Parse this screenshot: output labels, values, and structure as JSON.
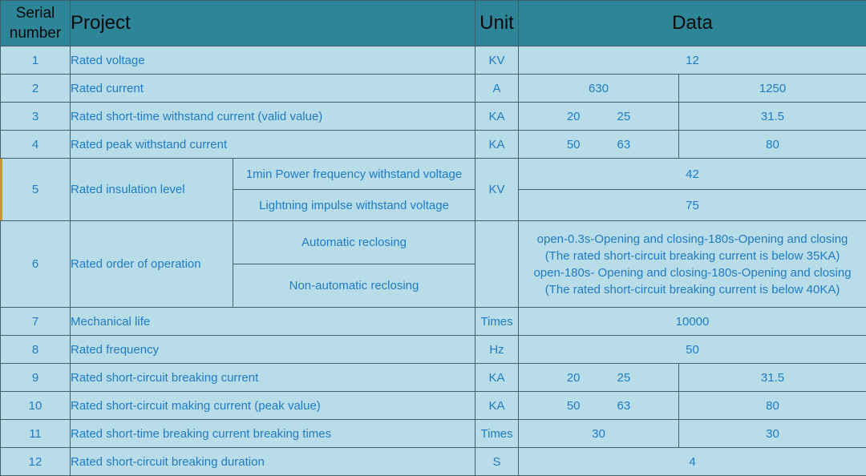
{
  "header": {
    "serial_number": "Serial number",
    "project": "Project",
    "unit": "Unit",
    "data": "Data"
  },
  "colors": {
    "header_bg": "#2e8598",
    "body_bg": "#b8dce8",
    "text_blue": "#1f7bc4",
    "border": "#40606b",
    "accent_stripe": "#c49a2c"
  },
  "rows": [
    {
      "no": "1",
      "project": "Rated voltage",
      "unit": "KV",
      "data_single": "12"
    },
    {
      "no": "2",
      "project": "Rated current",
      "unit": "A",
      "data_left": "630",
      "data_right": "1250"
    },
    {
      "no": "3",
      "project": "Rated short-time withstand current (valid value)",
      "unit": "KA",
      "data_left_a": "20",
      "data_left_b": "25",
      "data_right": "31.5"
    },
    {
      "no": "4",
      "project": "Rated peak withstand current",
      "unit": "KA",
      "data_left_a": "50",
      "data_left_b": "63",
      "data_right": "80"
    },
    {
      "no": "5",
      "project": "Rated insulation level",
      "unit": "KV",
      "sub_a": "1min Power frequency withstand voltage",
      "sub_b": "Lightning impulse withstand voltage",
      "data_a": "42",
      "data_b": "75"
    },
    {
      "no": "6",
      "project": "Rated order of operation",
      "unit": "",
      "sub_a": "Automatic reclosing",
      "sub_b": "Non-automatic reclosing",
      "data_line1": "open-0.3s-Opening and closing-180s-Opening and closing",
      "data_line2": "(The rated short-circuit breaking current is below 35KA)",
      "data_line3": "open-180s- Opening and closing-180s-Opening and closing",
      "data_line4": "(The rated short-circuit breaking current is below 40KA)"
    },
    {
      "no": "7",
      "project": "Mechanical life",
      "unit": "Times",
      "data_single": "10000"
    },
    {
      "no": "8",
      "project": "Rated frequency",
      "unit": "Hz",
      "data_single": "50"
    },
    {
      "no": "9",
      "project": "Rated short-circuit breaking current",
      "unit": "KA",
      "data_left_a": "20",
      "data_left_b": "25",
      "data_right": "31.5"
    },
    {
      "no": "10",
      "project": "Rated short-circuit making current (peak value)",
      "unit": "KA",
      "data_left_a": "50",
      "data_left_b": "63",
      "data_right": "80"
    },
    {
      "no": "11",
      "project": "Rated short-time breaking current breaking times",
      "unit": "Times",
      "data_left": "30",
      "data_right": "30"
    },
    {
      "no": "12",
      "project": "Rated short-circuit breaking duration",
      "unit": "S",
      "data_single": "4"
    }
  ]
}
